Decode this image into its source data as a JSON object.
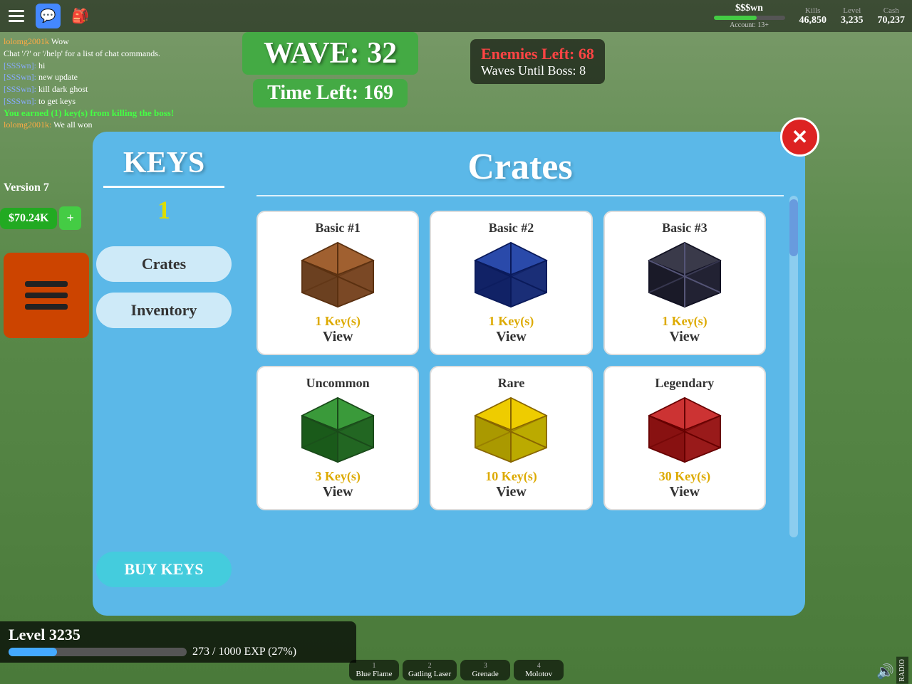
{
  "hud": {
    "username": "$$$wn",
    "account_label": "Account: 13+",
    "kills_label": "Kills",
    "kills_value": "46,850",
    "level_label": "Level",
    "level_value": "3,235",
    "cash_label": "Cash",
    "cash_value": "70,237"
  },
  "wave": {
    "title": "WAVE: 32",
    "timer_label": "Time Left:",
    "timer_value": "169",
    "enemies_left_label": "Enemies Left:",
    "enemies_left_value": "68",
    "waves_boss_label": "Waves Until Boss:",
    "waves_boss_value": "8"
  },
  "chat": {
    "messages": [
      {
        "username": "lolomg2001k",
        "username_color": "orange",
        "text": "Wow"
      },
      {
        "text": "Chat '/?' or '/help' for a list of chat commands."
      },
      {
        "username": "[SSSwn]",
        "text": "hi"
      },
      {
        "username": "[SSSwn]",
        "text": "new update"
      },
      {
        "username": "[SSSwn]",
        "text": "kill dark ghost"
      },
      {
        "username": "[SSSwn]",
        "text": "to get keys"
      }
    ],
    "earned_message": "You earned (1) key(s) from killing the boss!",
    "won_message": "lolomg2001k: We all won"
  },
  "version": "Version 7",
  "money": {
    "amount": "$70.24K",
    "plus_label": "+"
  },
  "modal": {
    "keys_title": "KEYS",
    "keys_count": "1",
    "title": "Crates",
    "nav": {
      "crates_label": "Crates",
      "inventory_label": "Inventory"
    },
    "buy_keys_label": "BUY KEYS",
    "close_label": "✕",
    "crates": [
      {
        "name": "Basic #1",
        "keys": "1 Key(s)",
        "view": "View",
        "color": "#8B4513",
        "type": "basic1"
      },
      {
        "name": "Basic #2",
        "keys": "1 Key(s)",
        "view": "View",
        "color": "#1a3a8a",
        "type": "basic2"
      },
      {
        "name": "Basic #3",
        "keys": "1 Key(s)",
        "view": "View",
        "color": "#2a2a3a",
        "type": "basic3"
      },
      {
        "name": "Uncommon",
        "keys": "3 Key(s)",
        "view": "View",
        "color": "#2a7a2a",
        "type": "uncommon"
      },
      {
        "name": "Rare",
        "keys": "10 Key(s)",
        "view": "View",
        "color": "#bbaa00",
        "type": "rare"
      },
      {
        "name": "Legendary",
        "keys": "30 Key(s)",
        "view": "View",
        "color": "#aa2222",
        "type": "legendary"
      }
    ]
  },
  "level_bar": {
    "level_label": "Level 3235",
    "exp_text": "273 / 1000 EXP (27%)"
  },
  "weapons": [
    {
      "slot": "1",
      "name": "Blue Flame"
    },
    {
      "slot": "2",
      "name": "Gatling Laser"
    },
    {
      "slot": "3",
      "name": "Grenade"
    },
    {
      "slot": "4",
      "name": "Molotov"
    }
  ],
  "radio": "RADIO"
}
